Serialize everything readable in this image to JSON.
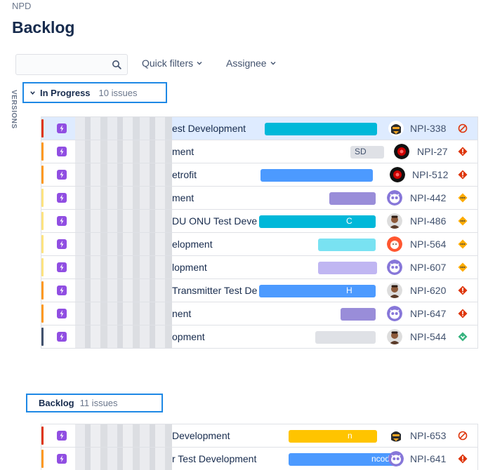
{
  "breadcrumb": "NPD",
  "title": "Backlog",
  "search": {
    "value": "",
    "placeholder": ""
  },
  "filters": [
    {
      "label": "Quick filters"
    },
    {
      "label": "Assignee"
    }
  ],
  "sidebar_tab": "VERSIONS",
  "sprints": [
    {
      "name": "In Progress",
      "count_label": "10 issues",
      "issues": [
        {
          "summary": "est Development",
          "key": "NPI-338",
          "priority": "blocker",
          "epic_color": "#00B8D9",
          "epic_label": "",
          "avatar": "dark-mask",
          "selected": true,
          "bar": "#DE350B"
        },
        {
          "summary": "ment",
          "key": "NPI-27",
          "priority": "highest",
          "epic_color": "#DFE1E6",
          "epic_label": "SD",
          "avatar": "red-orb",
          "selected": false,
          "bar": "#FF991F"
        },
        {
          "summary": "etrofit",
          "key": "NPI-512",
          "priority": "highest",
          "epic_color": "#4C9AFF",
          "epic_label": "",
          "avatar": "red-orb",
          "selected": false,
          "bar": "#FF991F"
        },
        {
          "summary": "ment",
          "key": "NPI-442",
          "priority": "medium",
          "epic_color": "#998DD9",
          "epic_label": "",
          "avatar": "owl",
          "selected": false,
          "bar": "#FFE380"
        },
        {
          "summary": "DU ONU Test Deve",
          "key": "NPI-486",
          "priority": "medium",
          "epic_color": "#00B8D9",
          "epic_label": "C",
          "avatar": "person",
          "selected": false,
          "bar": "#FFE380"
        },
        {
          "summary": "elopment",
          "key": "NPI-564",
          "priority": "medium",
          "epic_color": "#79E2F2",
          "epic_label": "",
          "avatar": "santa",
          "selected": false,
          "bar": "#FFE380"
        },
        {
          "summary": "lopment",
          "key": "NPI-607",
          "priority": "medium",
          "epic_color": "#C0B6F2",
          "epic_label": "",
          "avatar": "owl",
          "selected": false,
          "bar": "#FFE380"
        },
        {
          "summary": "Transmitter Test De",
          "key": "NPI-620",
          "priority": "highest",
          "epic_color": "#4C9AFF",
          "epic_label": "H",
          "avatar": "person",
          "selected": false,
          "bar": "#FF991F"
        },
        {
          "summary": "nent",
          "key": "NPI-647",
          "priority": "highest",
          "epic_color": "#998DD9",
          "epic_label": "",
          "avatar": "owl",
          "selected": false,
          "bar": "#FF991F"
        },
        {
          "summary": "opment",
          "key": "NPI-544",
          "priority": "lowest",
          "epic_color": "#DFE1E6",
          "epic_label": "",
          "avatar": "person",
          "selected": false,
          "bar": "#42526E"
        }
      ]
    },
    {
      "name": "Backlog",
      "count_label": "11 issues",
      "issues": [
        {
          "summary": "Development",
          "key": "NPI-653",
          "priority": "blocker",
          "epic_color": "#FFC400",
          "epic_label": "n",
          "avatar": "dark-mask",
          "selected": false,
          "bar": "#DE350B"
        },
        {
          "summary": "r Test Development",
          "key": "NPI-641",
          "priority": "highest",
          "epic_color": "#4C9AFF",
          "epic_label": "ncoder",
          "avatar": "owl",
          "selected": false,
          "bar": "#FF991F"
        }
      ]
    }
  ]
}
